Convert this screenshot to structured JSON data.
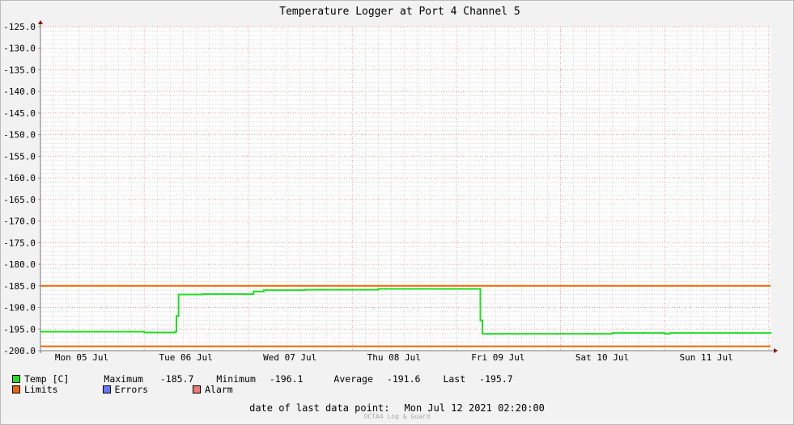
{
  "chart_data": {
    "type": "line",
    "title": "Temperature Logger at Port 4 Channel 5",
    "ylim": [
      -200.0,
      -125.0
    ],
    "y_ticks": [
      "-125.0",
      "-130.0",
      "-135.0",
      "-140.0",
      "-145.0",
      "-150.0",
      "-155.0",
      "-160.0",
      "-165.0",
      "-170.0",
      "-175.0",
      "-180.0",
      "-185.0",
      "-190.0",
      "-195.0",
      "-200.0"
    ],
    "x_tick_labels": [
      "Mon 05 Jul",
      "Tue 06 Jul",
      "Wed 07 Jul",
      "Thu 08 Jul",
      "Fri 09 Jul",
      "Sat 10 Jul",
      "Sun 11 Jul"
    ],
    "x_unit": "days since start of Mon 05 Jul",
    "xlim": [
      0,
      7.1
    ],
    "grid": true,
    "series": [
      {
        "name": "Temp [C]",
        "color": "#22dd22",
        "x": [
          0,
          0.55,
          1.0,
          1.06,
          1.3,
          1.31,
          1.33,
          1.55,
          1.56,
          1.95,
          2.05,
          2.15,
          2.5,
          2.55,
          3.25,
          3.9,
          4.2,
          4.23,
          4.25,
          5.1,
          5.5,
          5.9,
          6.0,
          6.05,
          6.5,
          6.8,
          7.08
        ],
        "y": [
          -195.6,
          -195.6,
          -195.8,
          -195.8,
          -195.6,
          -192.0,
          -187.0,
          -187.0,
          -186.9,
          -186.9,
          -186.3,
          -186.0,
          -186.0,
          -185.9,
          -185.7,
          -185.7,
          -185.7,
          -193.0,
          -196.1,
          -196.1,
          -195.9,
          -195.9,
          -196.1,
          -195.9,
          -195.9,
          -195.9,
          -195.7
        ]
      }
    ],
    "limits": {
      "name": "Limits",
      "color": "#ee6600",
      "values": [
        -185.0,
        -199.0
      ]
    }
  },
  "legend": {
    "temp_label": "Temp [C]",
    "maximum_label": "Maximum",
    "maximum_value": "-185.7",
    "minimum_label": "Minimum",
    "minimum_value": "-196.1",
    "average_label": "Average",
    "average_value": "-191.6",
    "last_label": "Last",
    "last_value": "-195.7",
    "limits_label": "Limits",
    "errors_label": "Errors",
    "alarm_label": "Alarm",
    "temp_color": "#22dd22",
    "limits_color": "#ee6600",
    "errors_color": "#6677ff",
    "alarm_color": "#ee7777"
  },
  "footer": {
    "date_label": "date of last data point:",
    "date_value": "Mon Jul 12 2021 02:20:00",
    "credit": "OCTA4 Log & Guard"
  }
}
